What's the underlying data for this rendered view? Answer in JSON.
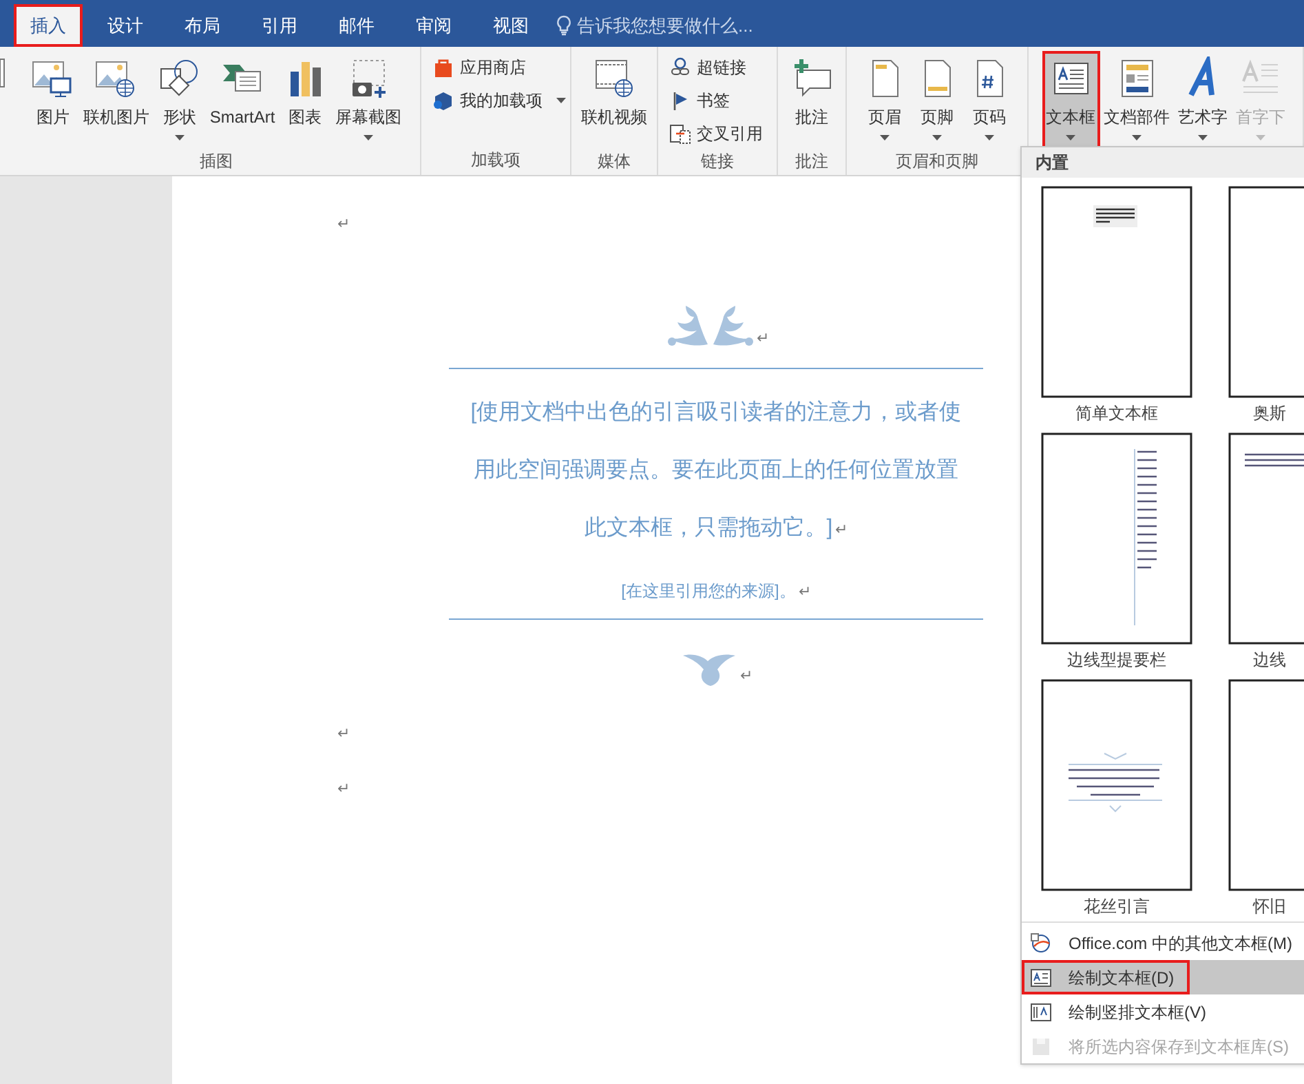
{
  "tabs": [
    {
      "label": "插入",
      "selected": true,
      "highlighted": true
    },
    {
      "label": "设计",
      "selected": false,
      "highlighted": false
    },
    {
      "label": "布局",
      "selected": false,
      "highlighted": false
    },
    {
      "label": "引用",
      "selected": false,
      "highlighted": false
    },
    {
      "label": "邮件",
      "selected": false,
      "highlighted": false
    },
    {
      "label": "审阅",
      "selected": false,
      "highlighted": false
    },
    {
      "label": "视图",
      "selected": false,
      "highlighted": false
    }
  ],
  "tell_me": {
    "placeholder": "告诉我您想要做什么..."
  },
  "ribbon_groups": [
    {
      "label": "插图",
      "buttons": [
        {
          "kind": "large",
          "label": "图片",
          "dropdown": false,
          "pressed": false,
          "disabled": false,
          "highlighted": false
        },
        {
          "kind": "large",
          "label": "联机图片",
          "dropdown": false,
          "pressed": false,
          "disabled": false,
          "highlighted": false
        },
        {
          "kind": "large",
          "label": "形状",
          "dropdown": true,
          "pressed": false,
          "disabled": false,
          "highlighted": false
        },
        {
          "kind": "large",
          "label": "SmartArt",
          "dropdown": false,
          "pressed": false,
          "disabled": false,
          "highlighted": false
        },
        {
          "kind": "large",
          "label": "图表",
          "dropdown": false,
          "pressed": false,
          "disabled": false,
          "highlighted": false
        },
        {
          "kind": "large",
          "label": "屏幕截图",
          "dropdown": true,
          "pressed": false,
          "disabled": false,
          "highlighted": false
        }
      ]
    },
    {
      "label": "加载项",
      "buttons": [
        {
          "kind": "small",
          "label": "应用商店",
          "dropdown": false
        },
        {
          "kind": "small",
          "label": "我的加载项",
          "dropdown": true
        }
      ]
    },
    {
      "label": "媒体",
      "buttons": [
        {
          "kind": "large",
          "label": "联机视频",
          "dropdown": false,
          "pressed": false,
          "disabled": false,
          "highlighted": false
        }
      ]
    },
    {
      "label": "链接",
      "buttons": [
        {
          "kind": "small",
          "label": "超链接",
          "dropdown": false
        },
        {
          "kind": "small",
          "label": "书签",
          "dropdown": false
        },
        {
          "kind": "small",
          "label": "交叉引用",
          "dropdown": false
        }
      ]
    },
    {
      "label": "批注",
      "buttons": [
        {
          "kind": "large",
          "label": "批注",
          "dropdown": false,
          "pressed": false,
          "disabled": false,
          "highlighted": false
        }
      ]
    },
    {
      "label": "页眉和页脚",
      "buttons": [
        {
          "kind": "large",
          "label": "页眉",
          "dropdown": true,
          "pressed": false,
          "disabled": false,
          "highlighted": false
        },
        {
          "kind": "large",
          "label": "页脚",
          "dropdown": true,
          "pressed": false,
          "disabled": false,
          "highlighted": false
        },
        {
          "kind": "large",
          "label": "页码",
          "dropdown": true,
          "pressed": false,
          "disabled": false,
          "highlighted": false
        }
      ]
    },
    {
      "buttons": [
        {
          "kind": "large",
          "label": "文本框",
          "dropdown": true,
          "pressed": true,
          "disabled": false,
          "highlighted": true
        },
        {
          "kind": "large",
          "label": "文档部件",
          "dropdown": true,
          "pressed": false,
          "disabled": false,
          "highlighted": false
        },
        {
          "kind": "large",
          "label": "艺术字",
          "dropdown": true,
          "pressed": false,
          "disabled": false,
          "highlighted": false
        },
        {
          "kind": "large",
          "label": "首字下",
          "dropdown": true,
          "pressed": false,
          "disabled": true,
          "highlighted": false
        }
      ]
    }
  ],
  "document": {
    "blocks": [
      {
        "kind": "empty",
        "mark": "↵"
      },
      {
        "kind": "ornament_top",
        "mark": "↵"
      },
      {
        "kind": "rule"
      },
      {
        "kind": "quote",
        "text": "[使用文档中出色的引言吸引读者的注意力，或者使用此空间强调要点。要在此页面上的任何位置放置此文本框，只需拖动它。]",
        "mark": "↵"
      },
      {
        "kind": "source",
        "text": "[在这里引用您的来源]。",
        "mark": "↵"
      },
      {
        "kind": "rule"
      },
      {
        "kind": "ornament_bottom",
        "mark": "↵"
      },
      {
        "kind": "empty",
        "mark": "↵"
      },
      {
        "kind": "empty",
        "mark": "↵"
      }
    ]
  },
  "textbox_menu": {
    "section": "内置",
    "gallery": [
      {
        "kind": "simple",
        "label": "简单文本框"
      },
      {
        "kind": "blank",
        "label": "奥斯"
      },
      {
        "kind": "sidebar",
        "label": "边线型提要栏"
      },
      {
        "kind": "topbar",
        "label": "边线"
      },
      {
        "kind": "filigree",
        "label": "花丝引言"
      },
      {
        "kind": "blank",
        "label": "怀旧"
      }
    ],
    "items": [
      {
        "label": "Office.com 中的其他文本框(M)",
        "selected": false,
        "disabled": false,
        "highlighted": false
      },
      {
        "label": "绘制文本框(D)",
        "selected": true,
        "disabled": false,
        "highlighted": true
      },
      {
        "label": "绘制竖排文本框(V)",
        "selected": false,
        "disabled": false,
        "highlighted": false
      },
      {
        "label": "将所选内容保存到文本框库(S)",
        "selected": false,
        "disabled": true,
        "highlighted": false
      }
    ]
  }
}
